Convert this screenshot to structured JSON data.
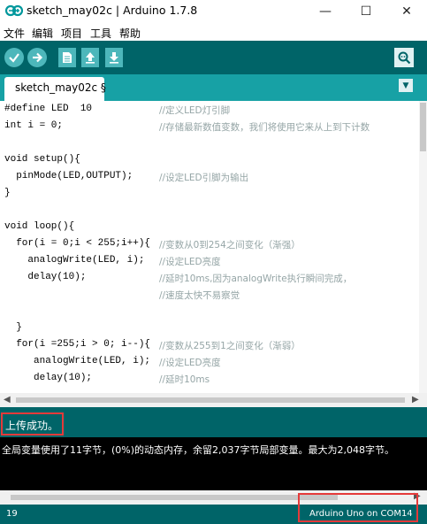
{
  "window": {
    "title": "sketch_may02c | Arduino 1.7.8",
    "minimize_glyph": "—",
    "maximize_glyph": "☐",
    "close_glyph": "✕"
  },
  "menu": [
    "文件",
    "编辑",
    "项目",
    "工具",
    "帮助"
  ],
  "toolbar": {
    "buttons": [
      "verify-icon",
      "upload-icon",
      "new-icon",
      "open-icon",
      "save-icon"
    ],
    "serial_monitor": "serial-monitor-icon"
  },
  "tab": {
    "label": "sketch_may02c §",
    "menu_glyph": "▼"
  },
  "code_lines": [
    {
      "code": "#define LED  10",
      "comment": "//定义LED灯引脚"
    },
    {
      "code": "int i = 0;",
      "comment": "//存储最新数值变数，我们将使用它来从上到下计数"
    },
    {
      "code": "",
      "comment": ""
    },
    {
      "code": "void setup(){",
      "comment": ""
    },
    {
      "code": "  pinMode(LED,OUTPUT);",
      "comment": "//设定LED引脚为输出"
    },
    {
      "code": "}",
      "comment": ""
    },
    {
      "code": "",
      "comment": ""
    },
    {
      "code": "void loop(){",
      "comment": ""
    },
    {
      "code": "  for(i = 0;i < 255;i++){",
      "comment": "//变数从0到254之间变化（渐强）"
    },
    {
      "code": "    analogWrite(LED, i);",
      "comment": "//设定LED亮度"
    },
    {
      "code": "    delay(10);",
      "comment": "//延时10ms,因为analogWrite执行瞬间完成，"
    },
    {
      "code": "",
      "comment": "//速度太快不易察觉"
    },
    {
      "code": "",
      "comment": ""
    },
    {
      "code": "  }",
      "comment": ""
    },
    {
      "code": "  for(i =255;i > 0; i--){",
      "comment": "//变数从255到1之间变化（渐弱）"
    },
    {
      "code": "     analogWrite(LED, i);",
      "comment": "//设定LED亮度"
    },
    {
      "code": "     delay(10);",
      "comment": "//延时10ms"
    }
  ],
  "status": {
    "message": "上传成功。"
  },
  "console": {
    "text": "全局变量使用了11字节，(0%)的动态内存，余留2,037字节局部变量。最大为2,048字节。"
  },
  "footer": {
    "line": "19",
    "board": "Arduino Uno on COM14"
  },
  "colors": {
    "toolbar": "#006468",
    "tab_bar": "#17a1a5",
    "button": "#4db7bb",
    "highlight": "#e53a3a"
  }
}
